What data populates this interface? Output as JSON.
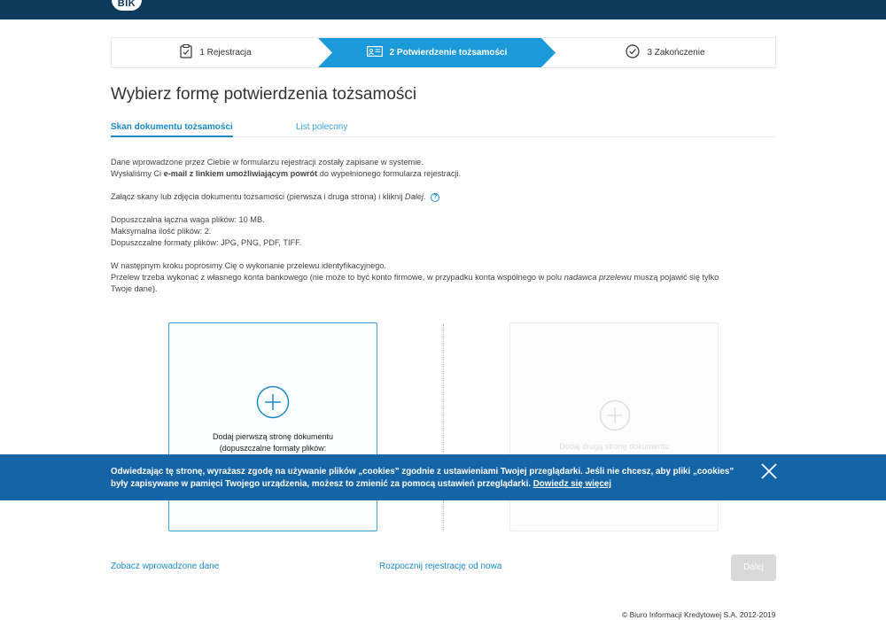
{
  "header": {
    "logo_text": "BIK"
  },
  "stepper": {
    "steps": [
      {
        "label": "1 Rejestracja",
        "icon": "clipboard-check-icon",
        "state": "done"
      },
      {
        "label": "2 Potwierdzenie tożsamości",
        "icon": "id-card-icon",
        "state": "active"
      },
      {
        "label": "3 Zakończenie",
        "icon": "check-circle-icon",
        "state": "pending"
      }
    ],
    "active_color": "#1a9ad9"
  },
  "page_title": "Wybierz formę potwierdzenia tożsamości",
  "tabs": [
    {
      "label": "Skan dokumentu tożsamości",
      "active": true
    },
    {
      "label": "List polecony",
      "active": false
    }
  ],
  "content": {
    "para1_line1": "Dane wprowadzone przez Ciebie w formularzu rejestracji zostały zapisane w systemie.",
    "para1_line2_pre": "Wysłaliśmy Ci ",
    "para1_line2_bold": "e-mail z linkiem umożliwiającym powrót",
    "para1_line2_post": " do wypełnionego formularza rejestracji.",
    "para2_pre": "Załącz skany lub zdjęcia dokumentu tożsamości (pierwsza i druga strona) i kliknij ",
    "para2_italic": "Dalej",
    "para2_post": ".",
    "help_icon": "question-circle-icon",
    "limit_size": "Dopuszczalna łączna waga plików: 10 MB.",
    "limit_count": "Maksymalna ilość plików: 2.",
    "limit_formats": "Dopuszczalne formaty plików: JPG, PNG, PDF, TIFF.",
    "para4_line1": "W następnym kroku poprosimy Cię o wykonanie przelewu identyfikacyjnego.",
    "para4_line2_pre": "Przelew trzeba wykonać z własnego konta bankowego (nie może to być konto firmowe, w przypadku konta wspólnego w polu ",
    "para4_line2_italic": "nadawca przelewu",
    "para4_line2_post": " muszą pojawić się tylko",
    "para4_line3": "Twoje dane)."
  },
  "upload": {
    "first_label": "Dodaj pierwszą stronę dokumentu",
    "first_sublabel": "(dopuszczalne formaty plików:",
    "second_label": "Dodaj drugą stronę dokumentu",
    "plus_icon": "plus-circle-icon"
  },
  "cookie_banner": {
    "text": "Odwiedzając tę stronę, wyrażasz zgodę na używanie plików „cookies” zgodnie z ustawieniami Twojej przeglądarki. Jeśli nie chcesz, aby pliki „cookies” były zapisywane w pamięci Twojego urządzenia, możesz to zmienić za pomocą ustawień przeglądarki. ",
    "link": "Dowiedz się więcej",
    "close_icon": "close-icon",
    "bg_color": "#1565a6"
  },
  "actions": {
    "view_data": "Zobacz wprowadzone dane",
    "restart": "Rozpocznij rejestrację od nowa",
    "next": "Dalej"
  },
  "footer": {
    "copyright": "© Biuro Informacji Kredytowej S.A. 2012-2019"
  }
}
